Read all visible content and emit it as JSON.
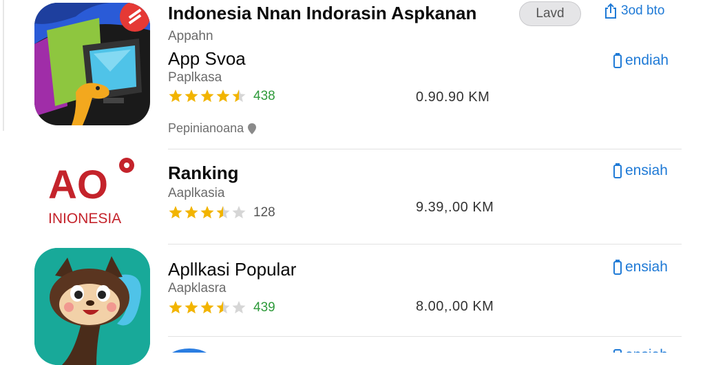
{
  "header": {
    "title": "Indonesia Nnan Indorasin Aspkanan",
    "pill_label": "Lavd",
    "action_label": "3od bto"
  },
  "apps": [
    {
      "title": "App Svoa",
      "subtitle_top": "Appahn",
      "subtitle": "Paplkasa",
      "rating": 4.5,
      "rating_count": "438",
      "price": "0.90.90 KM",
      "action": "endiah",
      "developer": "Pepinianoana",
      "icon": "tv-monitor-app-icon"
    },
    {
      "title": "Ranking",
      "subtitle": "Aaplkasia",
      "rating": 3.5,
      "rating_count": "128",
      "price": "9.39,.00 KM",
      "action": "ensiah",
      "logo_text": "AO",
      "logo_subtext": "INIONESIA",
      "icon": "ao-indonesia-logo"
    },
    {
      "title": "Apllkasi Popular",
      "subtitle": "Aapklasra",
      "rating": 3.5,
      "rating_count": "439",
      "price": "8.00,.00 KM",
      "action": "ensiah",
      "icon": "squirrel-mascot-icon"
    },
    {
      "action": "ensiah",
      "icon": "blue-app-icon"
    }
  ],
  "colors": {
    "accent": "#1f7ad6",
    "star_gold": "#f2b400",
    "star_green": "#2e9a3a",
    "logo_red": "#c4232b"
  }
}
